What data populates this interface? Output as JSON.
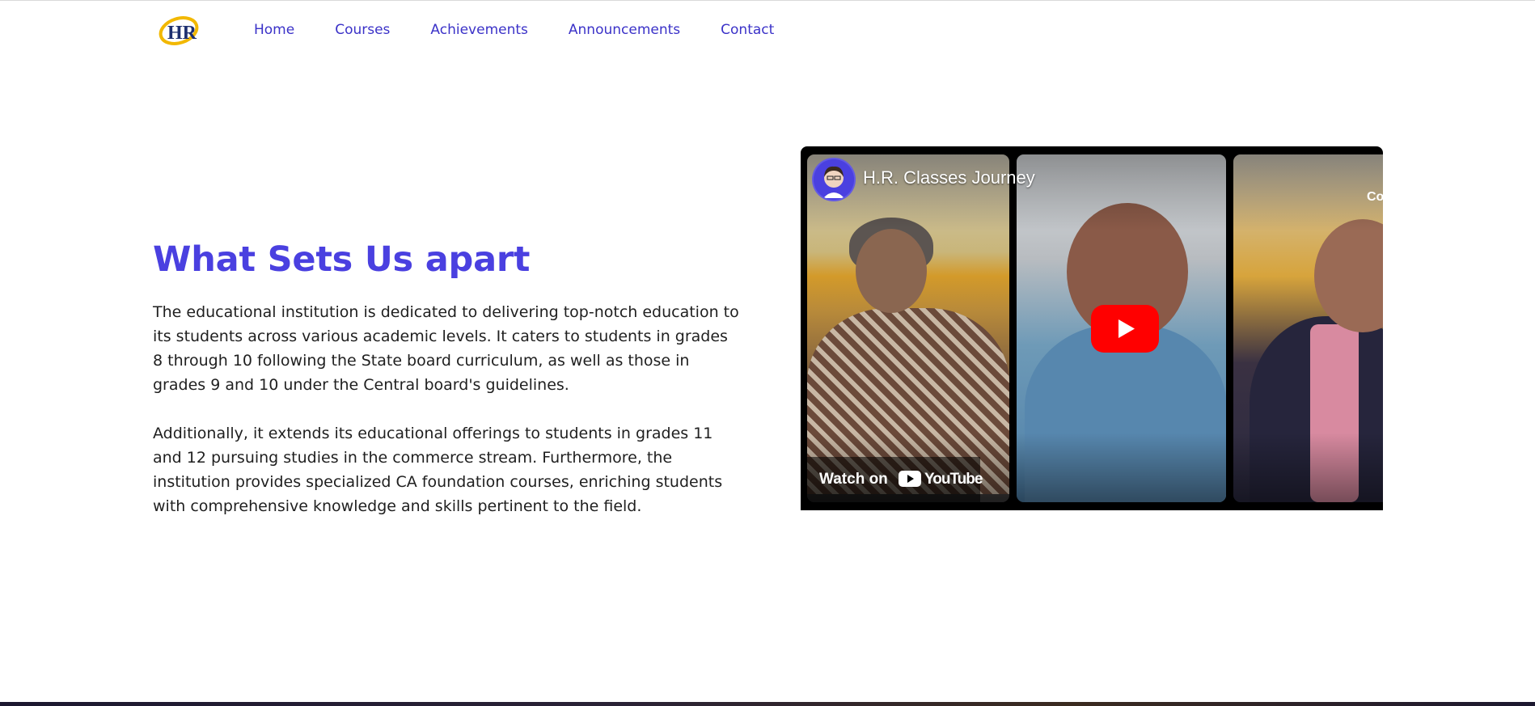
{
  "nav": {
    "logo_text": "HR",
    "links": [
      "Home",
      "Courses",
      "Achievements",
      "Announcements",
      "Contact"
    ]
  },
  "main": {
    "heading": "What Sets Us apart",
    "paragraphs": [
      "The educational institution is dedicated to delivering top-notch education to its students across various academic levels. It caters to students in grades 8 through 10 following the State board curriculum, as well as those in grades 9 and 10 under the Central board's guidelines.",
      "Additionally, it extends its educational offerings to students in grades 11 and 12 pursuing studies in the commerce stream. Furthermore, the institution provides specialized CA foundation courses, enriching students with comprehensive knowledge and skills pertinent to the field."
    ]
  },
  "video": {
    "title": "H.R. Classes Journey",
    "corner_text": "Co",
    "watch_on_label": "Watch on",
    "youtube_label": "YouTube"
  },
  "colors": {
    "accent": "#4a40e0",
    "nav_link": "#3b32c8",
    "logo_gold": "#f2b800",
    "logo_navy": "#1d2f6f",
    "play_red": "#ff0000"
  },
  "icons": {
    "logo": "hr-logo-icon",
    "play": "play-icon",
    "youtube": "youtube-logo-icon"
  }
}
